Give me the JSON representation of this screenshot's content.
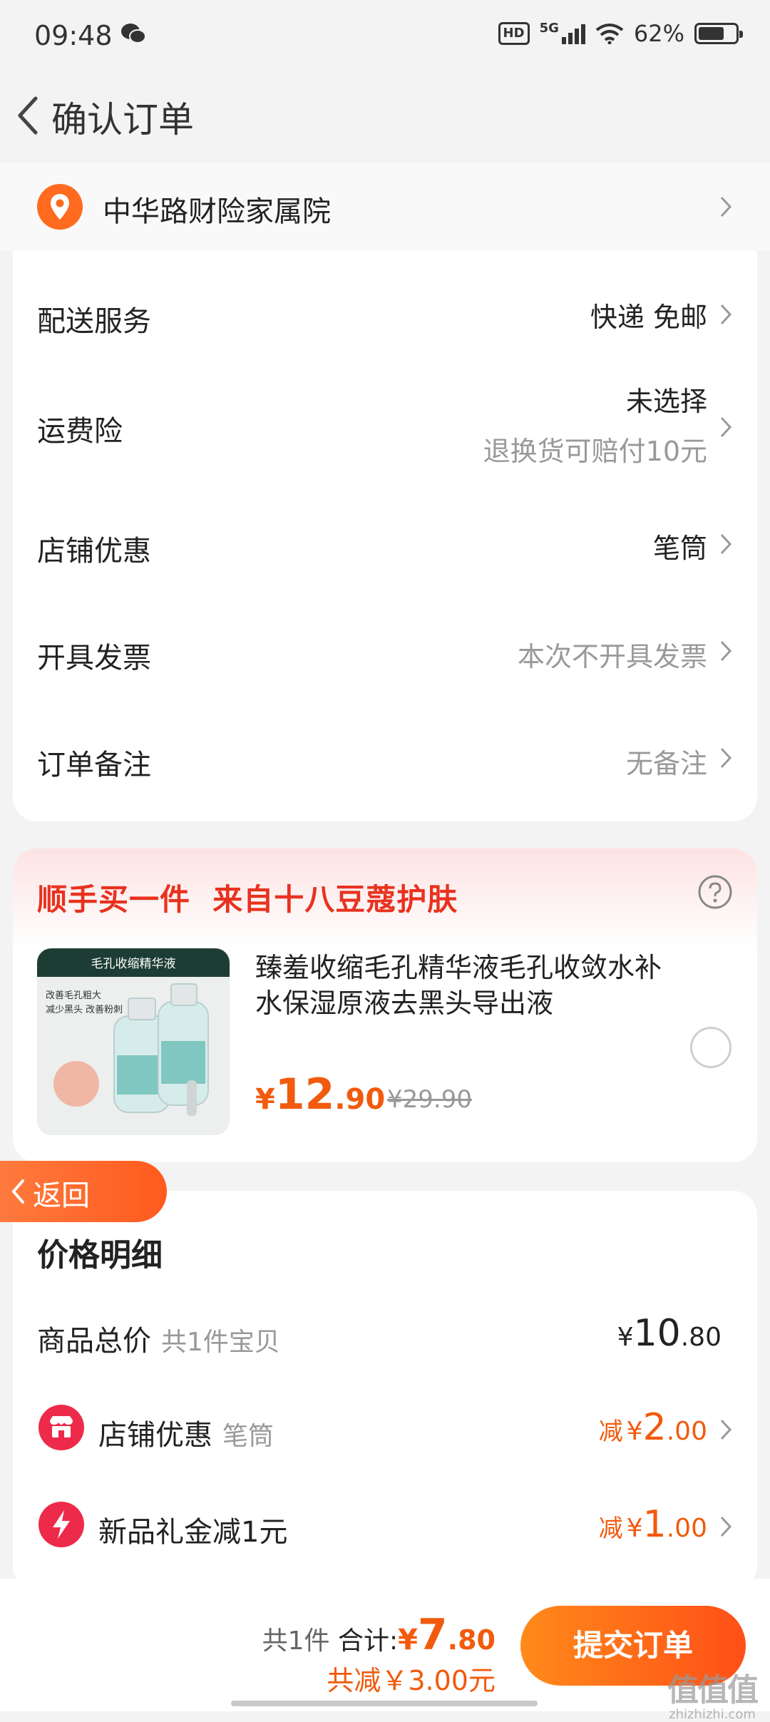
{
  "status_bar": {
    "time": "09:48",
    "network": "5G",
    "battery": "62%",
    "hd_label": "HD",
    "wechat_icon": "wechat-icon"
  },
  "nav": {
    "title": "确认订单",
    "back_icon": "chevron-left-icon"
  },
  "address": {
    "text": "中华路财险家属院",
    "icon": "location-pin-icon"
  },
  "order_options": [
    {
      "label": "配送服务",
      "value": "快递 免邮"
    },
    {
      "label": "运费险",
      "value": "未选择",
      "subvalue": "退换货可赔付10元"
    },
    {
      "label": "店铺优惠",
      "value": "笔筒"
    },
    {
      "label": "开具发票",
      "value": "本次不开具发票"
    },
    {
      "label": "订单备注",
      "value": "无备注"
    }
  ],
  "bundle": {
    "title": "顺手买一件  来自十八豆蔻护肤",
    "product": {
      "name": "臻羞收缩毛孔精华液毛孔收敛水补水保湿原液去黑头导出液",
      "price_currency": "¥",
      "price_int": "12",
      "price_dec": ".90",
      "original_price": "¥29.90",
      "image_caption": "毛孔收缩精华液",
      "image_lines": [
        "改善毛孔粗大",
        "减少黑头 改善粉刺"
      ]
    }
  },
  "return_button": {
    "label": "返回"
  },
  "price_detail": {
    "title": "价格明细",
    "rows": [
      {
        "label": "商品总价",
        "sub": "共1件宝贝",
        "currency": "¥",
        "amount_int": "10",
        "amount_dec": ".80"
      },
      {
        "label": "店铺优惠",
        "sub": "笔筒",
        "prefix": "减",
        "currency": "¥",
        "amount_int": "2",
        "amount_dec": ".00",
        "icon": "shop-icon"
      },
      {
        "label": "新品礼金减1元",
        "sub": "",
        "prefix": "减",
        "currency": "¥",
        "amount_int": "1",
        "amount_dec": ".00",
        "icon": "lightning-icon"
      }
    ]
  },
  "footer": {
    "count_text": "共1件",
    "total_label": "合计:",
    "total_currency": "¥",
    "total_int": "7",
    "total_dec": ".80",
    "saved_text": "共减￥3.00元",
    "submit_label": "提交订单"
  },
  "watermark": {
    "logo": "值值值",
    "url": "zhizhizhi.com"
  },
  "colors": {
    "accent": "#f25a0d",
    "bundle_red": "#e8321f",
    "icon_red": "#ee2a4b"
  }
}
